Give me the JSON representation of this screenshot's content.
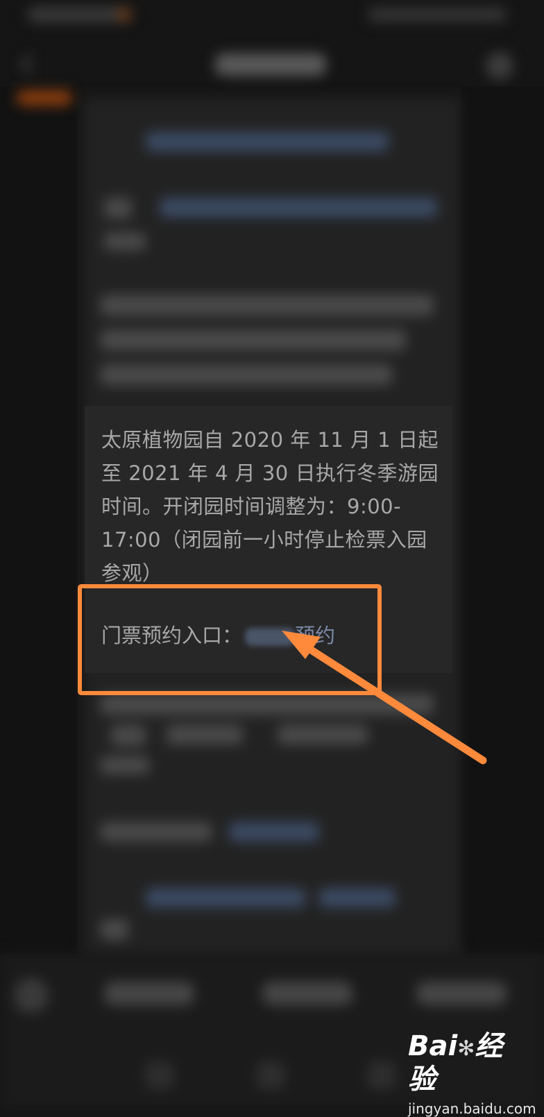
{
  "article": {
    "notice_text": "太原植物园自 2020 年 11 月 1 日起至 2021 年 4 月 30 日执行冬季游园时间。开闭园时间调整为：9:00-17:00（闭园前一小时停止检票入园参观）",
    "ticket_entry_label": "门票预约入口：",
    "ticket_entry_link": "预约"
  },
  "watermark": {
    "logo": "Bai",
    "logo_suffix": "经验",
    "subtext": "jingyan.baidu.com"
  },
  "colors": {
    "highlight": "#ff8a3c",
    "link": "#7c8aa8",
    "background": "#151515"
  },
  "icons": {
    "back": "back-arrow-icon",
    "share": "share-icon",
    "annotation": "annotation-arrow-icon"
  }
}
